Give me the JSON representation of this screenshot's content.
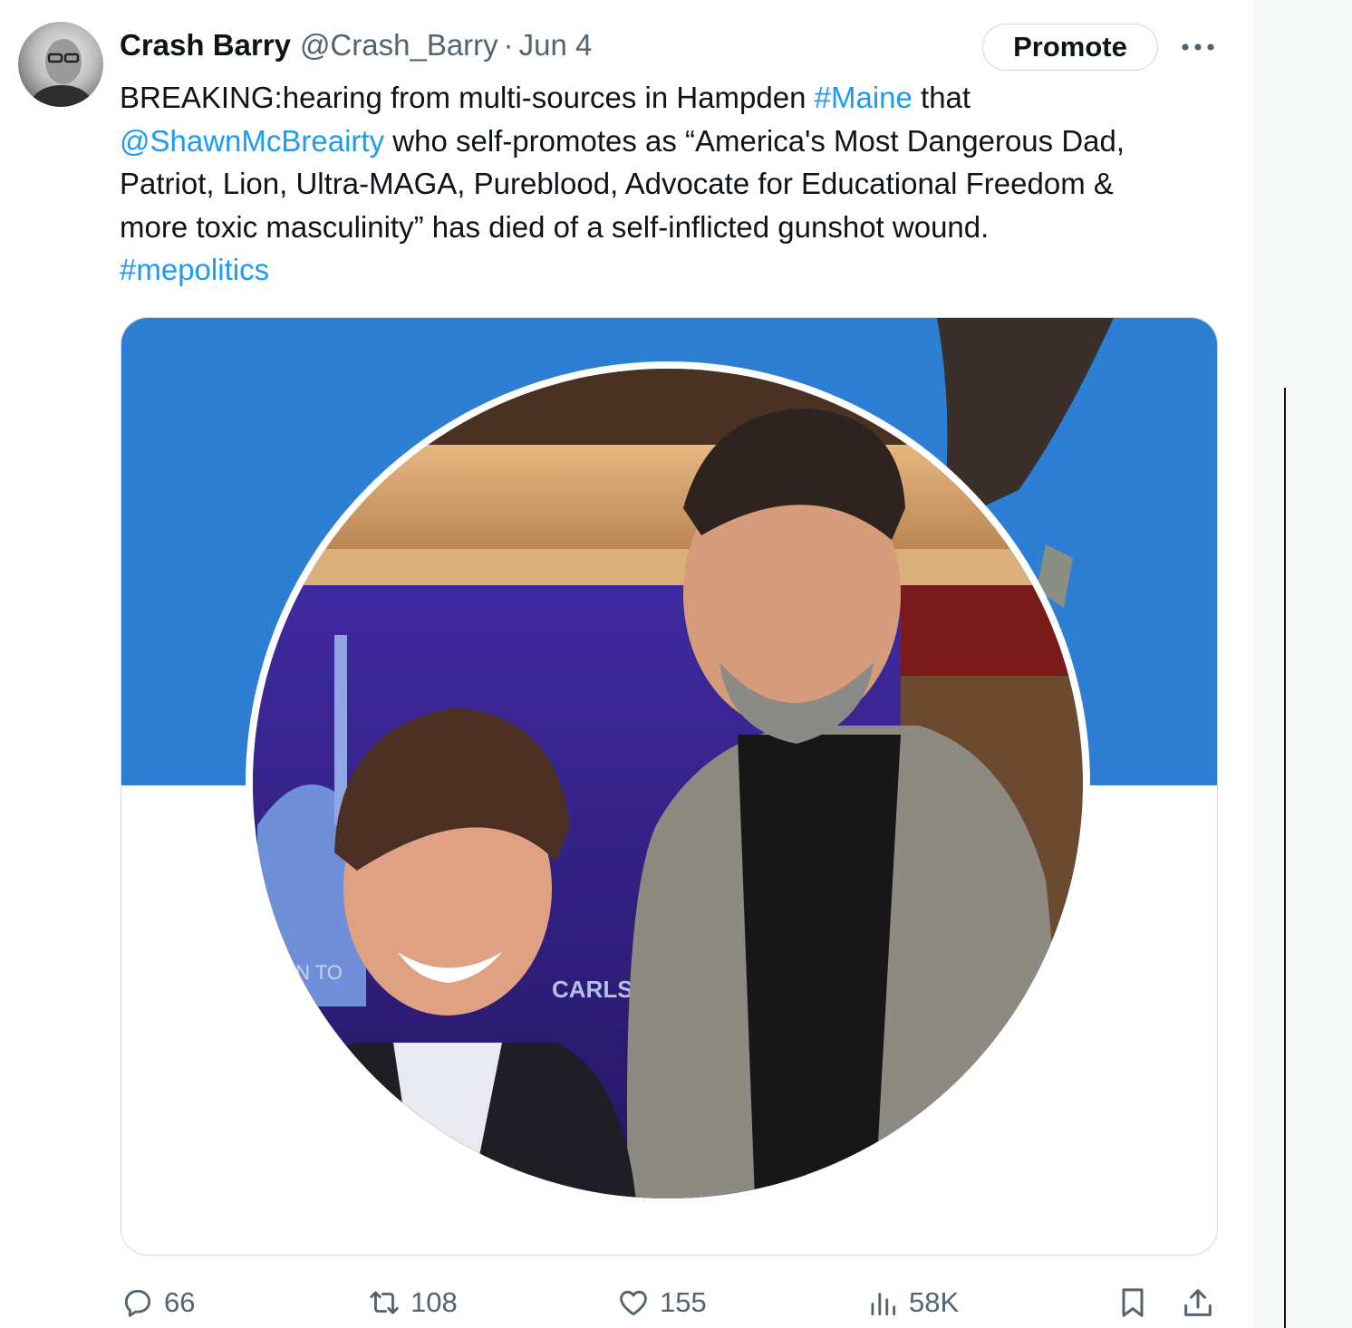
{
  "tweet": {
    "author_name": "Crash Barry",
    "handle": "@Crash_Barry",
    "separator": "·",
    "date": "Jun 4",
    "promote_label": "Promote",
    "text_lines": [
      [
        {
          "t": "BREAKING:hearing from multi-sources in Hampden "
        },
        {
          "t": "#Maine",
          "link": true
        },
        {
          "t": " that"
        }
      ],
      [
        {
          "t": "@ShawnMcBreairty",
          "link": true
        },
        {
          "t": " who self-promotes as “America's Most Dangerous Dad,"
        }
      ],
      [
        {
          "t": "Patriot, Lion, Ultra-MAGA, Pureblood, Advocate for Educational Freedom &"
        }
      ],
      [
        {
          "t": "more toxic masculinity” has died of a self-inflicted gunshot wound."
        }
      ],
      [
        {
          "t": "#mepolitics",
          "link": true
        }
      ]
    ],
    "media": {
      "banner_color": "#2d7fd3",
      "image_text_left": "ON TO",
      "image_text_right": "CARLSC"
    },
    "stats": {
      "replies": "66",
      "reposts": "108",
      "likes": "155",
      "views": "58K"
    }
  },
  "icons": {
    "more": "more-horizontal-icon",
    "reply": "reply-bubble-icon",
    "repost": "repost-arrows-icon",
    "like": "heart-icon",
    "views": "views-bar-chart-icon",
    "bookmark": "bookmark-icon",
    "share": "share-upload-icon"
  },
  "colors": {
    "link": "#1d9bf0",
    "secondary_text": "#536471",
    "border": "#cfd9de"
  }
}
